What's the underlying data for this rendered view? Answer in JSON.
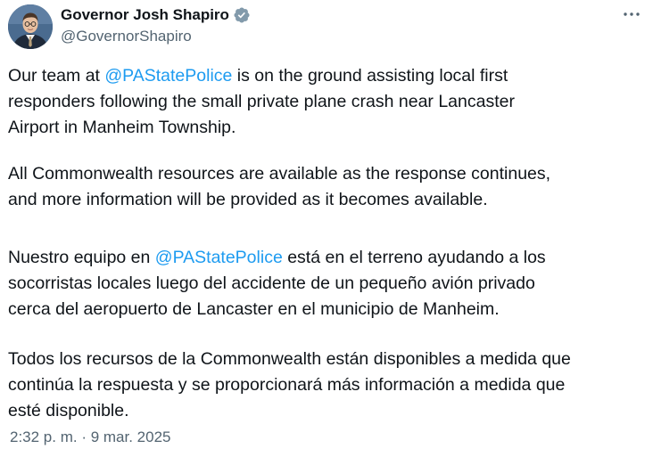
{
  "author": {
    "name": "Governor Josh Shapiro",
    "handle": "@GovernorShapiro",
    "verified_icon": "verified-badge-gray",
    "avatar_icon": "profile-photo"
  },
  "menu": {
    "icon": "more-horizontal-icon"
  },
  "tweet": {
    "p1": {
      "l1_pre": "Our team at ",
      "l1_mention": "@PAStatePolice",
      "l1_post": " is on the ground assisting local first",
      "l2": "responders following the small private plane crash near Lancaster",
      "l3": "Airport in Manheim Township."
    },
    "p2": {
      "l1": "All Commonwealth resources are available as the response continues,",
      "l2": "and more information will be provided as it becomes available."
    },
    "p3": {
      "l1_pre": "Nuestro equipo en ",
      "l1_mention": "@PAStatePolice",
      "l1_post": " está en el terreno ayudando a los",
      "l2": "socorristas locales luego del accidente de un pequeño avión privado",
      "l3": "cerca del aeropuerto de Lancaster en el municipio de Manheim."
    },
    "p4": {
      "l1": "Todos los recursos de la Commonwealth están disponibles a medida que",
      "l2": "continúa la respuesta y se proporcionará más información a medida que",
      "l3": "esté disponible."
    }
  },
  "timestamp": "2:32 p. m. · 9 mar. 2025",
  "colors": {
    "link": "#1d9bf0",
    "text": "#0f1419",
    "secondary": "#536471",
    "verified_badge": "#829aab"
  }
}
